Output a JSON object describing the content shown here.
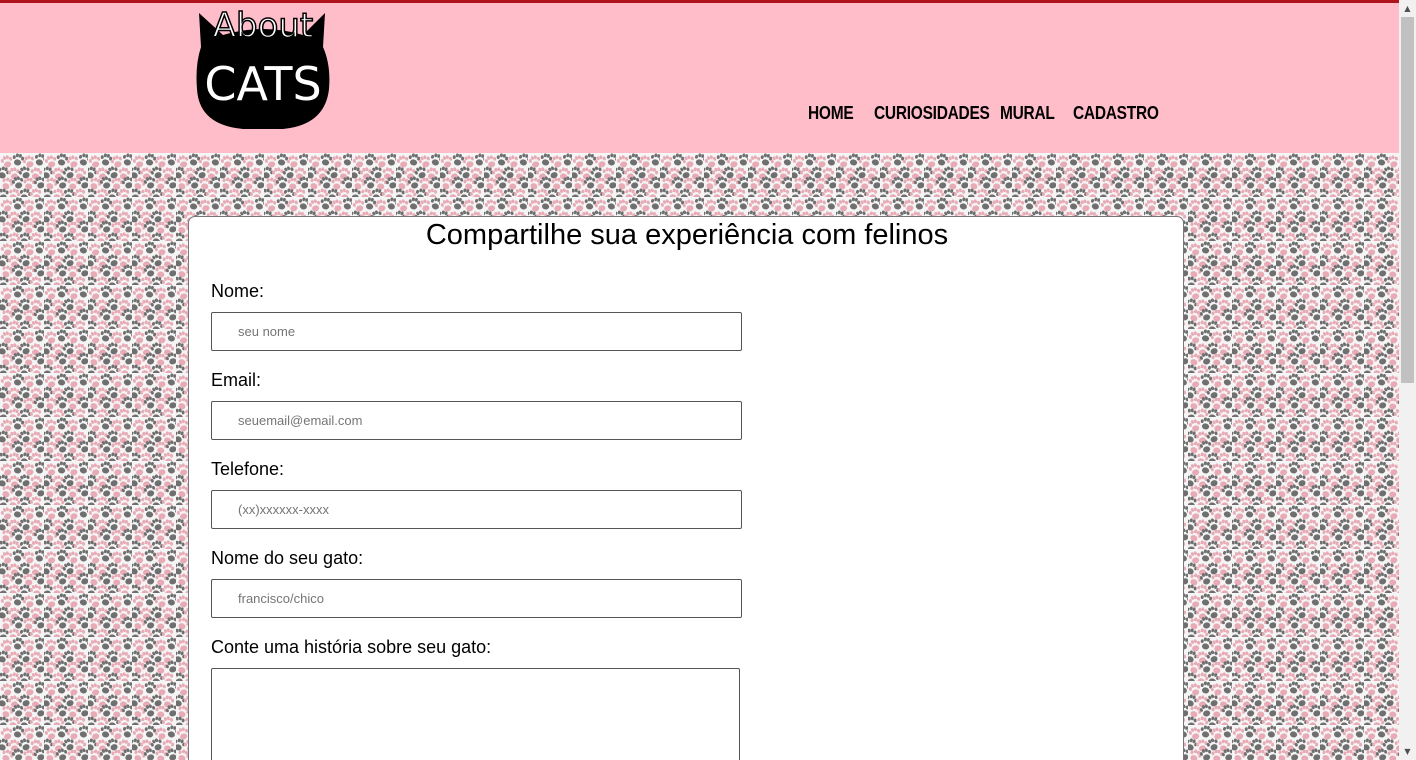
{
  "header": {
    "logo": {
      "line1": "About",
      "line2": "CATS"
    },
    "nav": [
      {
        "label": "HOME"
      },
      {
        "label": "CURIOSIDADES"
      },
      {
        "label": "MURAL"
      },
      {
        "label": "CADASTRO"
      }
    ]
  },
  "form": {
    "title": "Compartilhe sua experiência com felinos",
    "fields": [
      {
        "label": "Nome:",
        "placeholder": "seu nome",
        "value": ""
      },
      {
        "label": "Email:",
        "placeholder": "seuemail@email.com",
        "value": ""
      },
      {
        "label": "Telefone:",
        "placeholder": "(xx)xxxxxx-xxxx",
        "value": ""
      },
      {
        "label": "Nome do seu gato:",
        "placeholder": "francisco/chico",
        "value": ""
      }
    ],
    "story": {
      "label": "Conte uma história sobre seu gato:",
      "value": ""
    }
  },
  "colors": {
    "header_bg": "#ffbcc9",
    "top_accent": "#b0121b",
    "paw_pink": "#e8aab5",
    "paw_gray": "#6f6f6f"
  },
  "icons": {
    "scroll_up": "scroll-up-arrow-icon",
    "scroll_down": "scroll-down-arrow-icon",
    "pattern": "paw-print-icon"
  }
}
